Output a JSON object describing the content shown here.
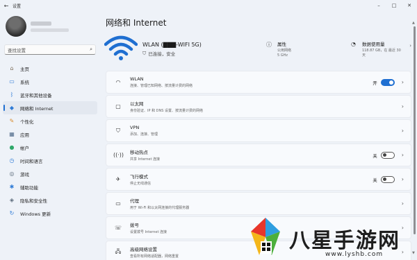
{
  "window": {
    "title": "设置",
    "back_icon": "arrow-left-icon",
    "controls": [
      "–",
      "□",
      "✕"
    ]
  },
  "sidebar": {
    "search_placeholder": "查找设置",
    "items": [
      {
        "label": "主页",
        "icon": "home-icon",
        "glyph": "⌂",
        "color": "#7a6a55"
      },
      {
        "label": "系统",
        "icon": "monitor-icon",
        "glyph": "▭",
        "color": "#2f7bd6"
      },
      {
        "label": "蓝牙和其他设备",
        "icon": "bluetooth-icon",
        "glyph": "ᛒ",
        "color": "#2f7bd6"
      },
      {
        "label": "网络和 Internet",
        "icon": "wifi-diamond-icon",
        "glyph": "◆",
        "color": "#2f7bd6",
        "active": true
      },
      {
        "label": "个性化",
        "icon": "brush-icon",
        "glyph": "✎",
        "color": "#d88a2a"
      },
      {
        "label": "应用",
        "icon": "apps-icon",
        "glyph": "▦",
        "color": "#4e6a8a"
      },
      {
        "label": "帐户",
        "icon": "account-icon",
        "glyph": "●",
        "color": "#2fa86a"
      },
      {
        "label": "时间和语言",
        "icon": "globe-clock-icon",
        "glyph": "◷",
        "color": "#2f7bd6"
      },
      {
        "label": "游戏",
        "icon": "gamepad-icon",
        "glyph": "◎",
        "color": "#5a6a7a"
      },
      {
        "label": "辅助功能",
        "icon": "accessibility-icon",
        "glyph": "✱",
        "color": "#2f7bd6"
      },
      {
        "label": "隐私和安全性",
        "icon": "shield-icon",
        "glyph": "◈",
        "color": "#5a6a7a"
      },
      {
        "label": "Windows 更新",
        "icon": "update-icon",
        "glyph": "↻",
        "color": "#2f7bd6"
      }
    ]
  },
  "main": {
    "title": "网络和 Internet",
    "network": {
      "name": "WLAN (▇▇▇-WIFI 5G)",
      "status": "已连接，安全"
    },
    "properties": {
      "title": "属性",
      "sub1": "公用网络",
      "sub2": "5 GHz"
    },
    "data_usage": {
      "title": "数据使用量",
      "sub": "118.87 GB，在 最近 30 天"
    },
    "rows": [
      {
        "title": "WLAN",
        "sub": "连接、管理已知网络、按流量计费的网络",
        "icon": "wifi-icon",
        "glyph": "◠",
        "toggle": "on",
        "toggle_label": "开"
      },
      {
        "title": "以太网",
        "sub": "身份验证、IP 和 DNS 设置、按流量计费的网络",
        "icon": "ethernet-icon",
        "glyph": "▢",
        "toggle": "",
        "toggle_label": ""
      },
      {
        "title": "VPN",
        "sub": "添加、连接、管理",
        "icon": "vpn-shield-icon",
        "glyph": "⛉",
        "toggle": "",
        "toggle_label": ""
      },
      {
        "title": "移动热点",
        "sub": "共享 Internet 连接",
        "icon": "hotspot-icon",
        "glyph": "((·))",
        "toggle": "off",
        "toggle_label": "关"
      },
      {
        "title": "飞行模式",
        "sub": "停止无线通信",
        "icon": "airplane-icon",
        "glyph": "✈",
        "toggle": "off",
        "toggle_label": "关"
      },
      {
        "title": "代理",
        "sub": "用于 Wi-Fi 和以太网连接的代理服务器",
        "icon": "proxy-icon",
        "glyph": "▭",
        "toggle": "",
        "toggle_label": ""
      },
      {
        "title": "拨号",
        "sub": "设置拨号 Internet 连接",
        "icon": "dialup-icon",
        "glyph": "☏",
        "toggle": "",
        "toggle_label": ""
      },
      {
        "title": "高级网络设置",
        "sub": "查看所有网络适配器，网络重置",
        "icon": "advanced-network-icon",
        "glyph": "🖧",
        "toggle": "",
        "toggle_label": ""
      }
    ]
  },
  "watermark": {
    "title": "八星手游网",
    "url": "www.lyshb.com"
  },
  "colors": {
    "accent": "#1f6fd1",
    "background": "#eef2f8",
    "card": "#f8fafd"
  }
}
